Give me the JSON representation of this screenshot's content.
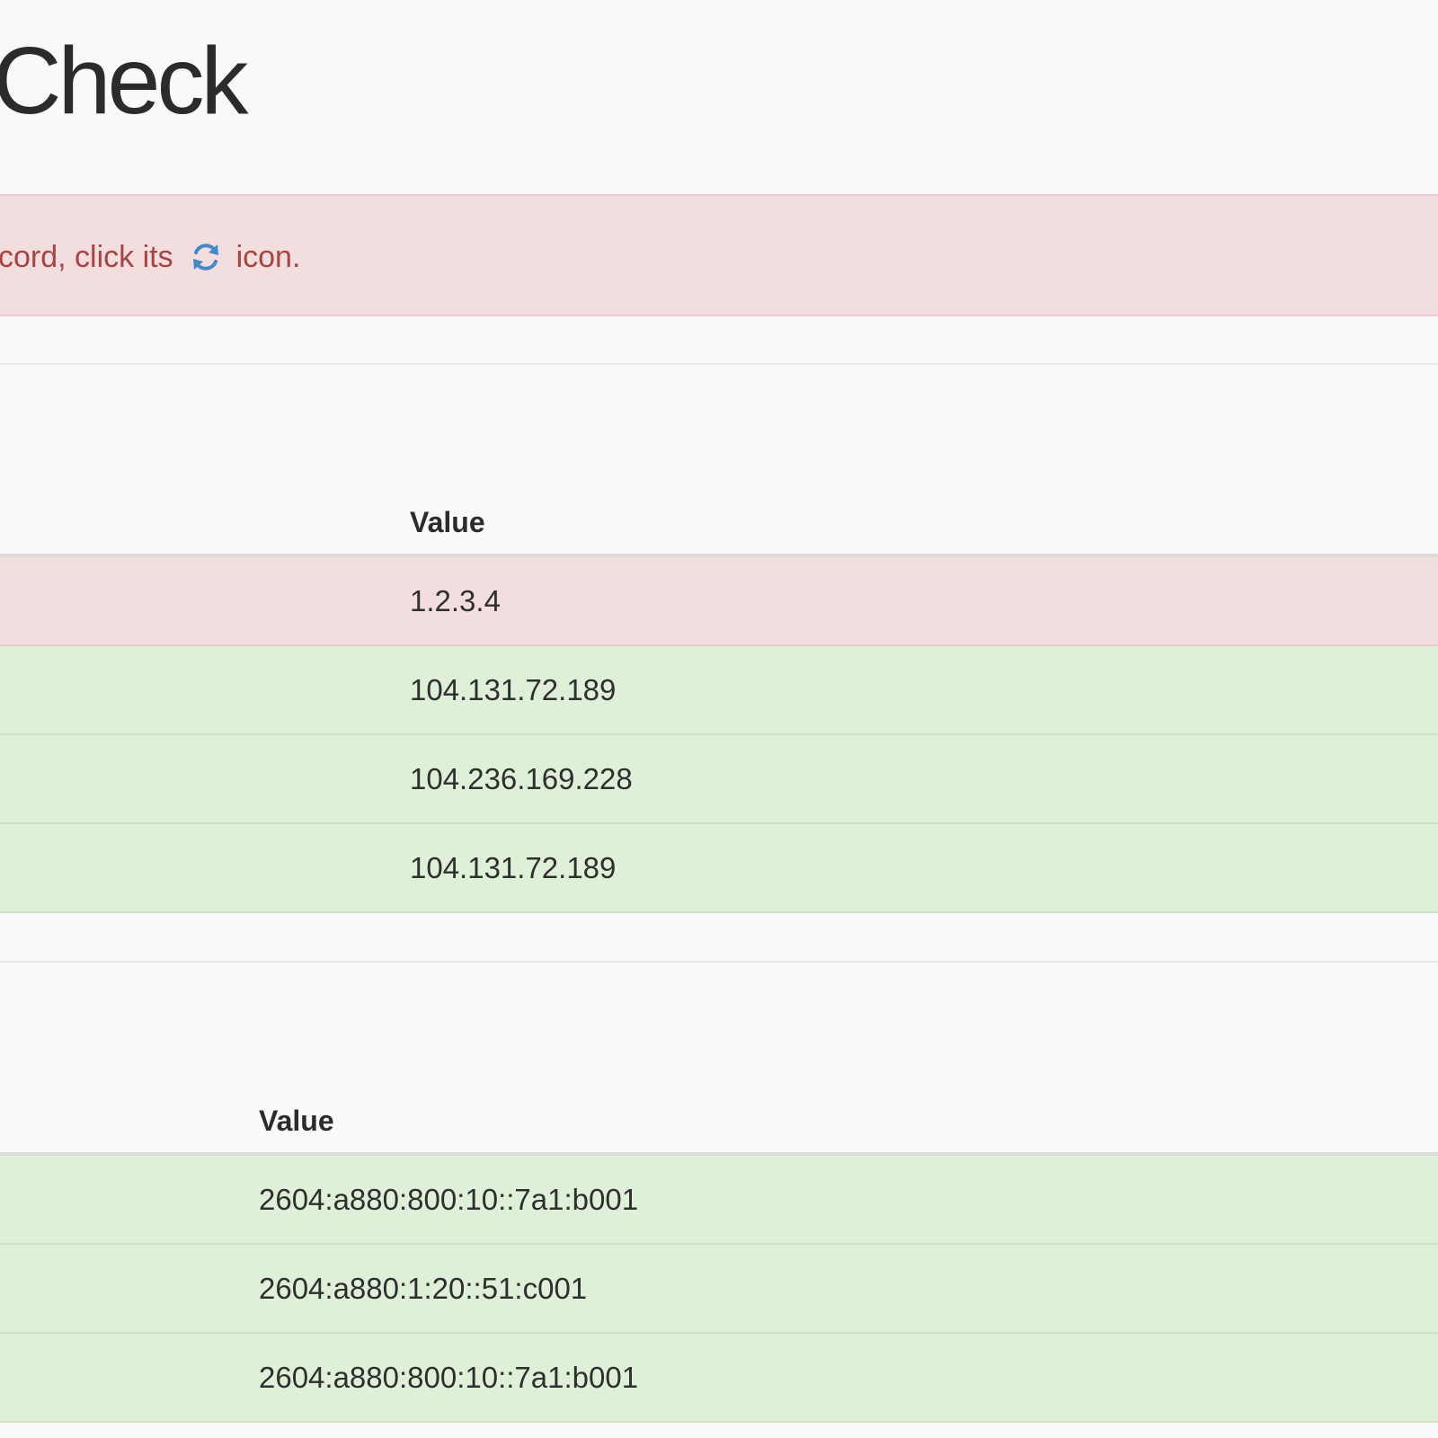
{
  "page": {
    "title": "Check"
  },
  "alert": {
    "text_before": "cord, click its",
    "icon": "refresh-icon",
    "text_after": "icon.",
    "color": "#a94442",
    "background": "#f2dede"
  },
  "ipv4_table": {
    "header": "Value",
    "rows": [
      {
        "value": "1.2.3.4",
        "status": "error"
      },
      {
        "value": "104.131.72.189",
        "status": "ok"
      },
      {
        "value": "104.236.169.228",
        "status": "ok"
      },
      {
        "value": "104.131.72.189",
        "status": "ok"
      }
    ]
  },
  "ipv6_table": {
    "header": "Value",
    "rows": [
      {
        "value": "2604:a880:800:10::7a1:b001",
        "status": "ok"
      },
      {
        "value": "2604:a880:1:20::51:c001",
        "status": "ok"
      },
      {
        "value": "2604:a880:800:10::7a1:b001",
        "status": "ok"
      }
    ]
  },
  "colors": {
    "ok_row": "#dff0d8",
    "error_row": "#f2dede",
    "refresh_icon": "#428bca"
  }
}
